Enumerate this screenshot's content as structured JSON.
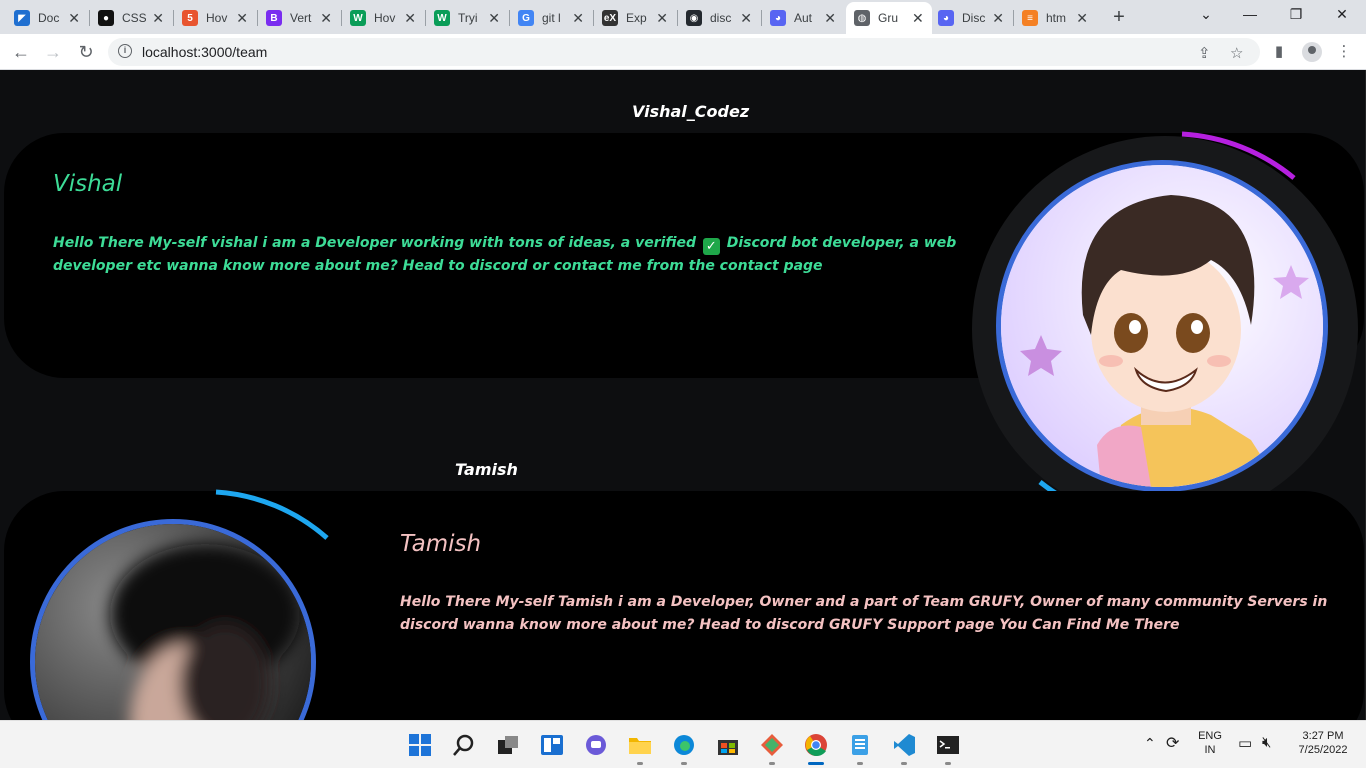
{
  "browser": {
    "tabs": [
      {
        "label": "Doc",
        "color": "#1f6fd0",
        "glyph": "◤"
      },
      {
        "label": "CSS",
        "color": "#111111",
        "glyph": "●"
      },
      {
        "label": "Hov",
        "color": "#e8542f",
        "glyph": "5"
      },
      {
        "label": "Vert",
        "color": "#7a2df0",
        "glyph": "B"
      },
      {
        "label": "Hov",
        "color": "#0a9d58",
        "glyph": "W"
      },
      {
        "label": "Tryi",
        "color": "#0a9d58",
        "glyph": "W"
      },
      {
        "label": "git l",
        "color": "#4285f4",
        "glyph": "G"
      },
      {
        "label": "Exp",
        "color": "#333333",
        "glyph": "eX"
      },
      {
        "label": "disc",
        "color": "#24292f",
        "glyph": "◉"
      },
      {
        "label": "Aut",
        "color": "#5865f2",
        "glyph": "◕"
      },
      {
        "label": "Gru",
        "color": "#5f6368",
        "glyph": "◍",
        "active": true
      },
      {
        "label": "Disc",
        "color": "#5865f2",
        "glyph": "◕"
      },
      {
        "label": "htm",
        "color": "#f48024",
        "glyph": "≡"
      }
    ],
    "url": "localhost:3000/team"
  },
  "team": {
    "member1": {
      "heading": "Vishal_Codez",
      "name": "Vishal",
      "desc_part1": "Hello There My-self vishal i am a Developer working with tons of ideas, a verified",
      "desc_part2": "Discord bot developer, a web developer etc wanna know more about me? Head to discord or contact me from the contact page",
      "accent": "#3ddc97"
    },
    "member2": {
      "heading": "Tamish",
      "name": "Tamish",
      "desc": "Hello There My-self Tamish i am a Developer, Owner and a part of Team GRUFY, Owner of many community Servers in discord wanna know more about me? Head to discord GRUFY Support page You Can Find Me There",
      "accent": "#f4c2c2"
    }
  },
  "taskbar": {
    "lang_top": "ENG",
    "lang_bottom": "IN",
    "time": "3:27 PM",
    "date": "7/25/2022"
  }
}
